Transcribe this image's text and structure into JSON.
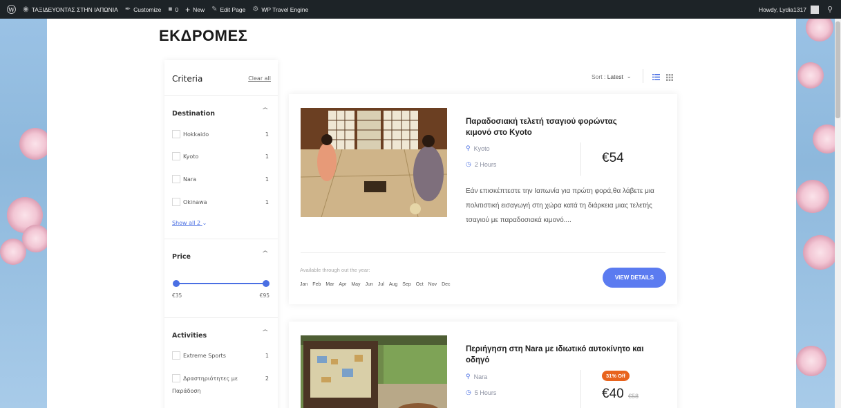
{
  "admin_bar": {
    "site_name": "ΤΑΞΙΔΕΥΟΝΤΑΣ ΣΤΗΝ ΙΑΠΩΝΙΑ",
    "customize": "Customize",
    "comments_count": "0",
    "new": "New",
    "edit_page": "Edit Page",
    "travel_engine": "WP Travel Engine",
    "howdy": "Howdy, Lydia1317"
  },
  "page": {
    "title": "ΕΚΔΡΟΜΕΣ"
  },
  "sidebar": {
    "heading": "Criteria",
    "clear_all": "Clear all",
    "destination": {
      "title": "Destination",
      "items": [
        {
          "label": "Hokkaido",
          "count": "1"
        },
        {
          "label": "Kyoto",
          "count": "1"
        },
        {
          "label": "Nara",
          "count": "1"
        },
        {
          "label": "Okinawa",
          "count": "1"
        }
      ],
      "show_all": "Show all 2"
    },
    "price": {
      "title": "Price",
      "min": "€35",
      "max": "€95"
    },
    "activities": {
      "title": "Activities",
      "items": [
        {
          "label": "Extreme Sports",
          "count": "1"
        },
        {
          "label": "Δραστηριότητες με",
          "label2": "Παράδοση",
          "count": "2"
        }
      ]
    }
  },
  "toolbar": {
    "sort_label": "Sort :",
    "sort_value": "Latest"
  },
  "trips": [
    {
      "title_line1": "Παραδοσιακή τελετή τσαγιού φορώντας",
      "title_line2": "κιμονό στο Kyoto",
      "location": "Kyoto",
      "duration": "2 Hours",
      "price": "€54",
      "desc": "Εάν επισκέπτεστε την Ιαπωνία για πρώτη φορά,θα λάβετε μια πολιτιστική εισαγωγή στη χώρα κατά τη διάρκεια μιας τελετής τσαγιού με παραδοσιακά κιμονό....",
      "availability": "Available through out the year:",
      "months": [
        "Jan",
        "Feb",
        "Mar",
        "Apr",
        "May",
        "Jun",
        "Jul",
        "Aug",
        "Sep",
        "Oct",
        "Nov",
        "Dec"
      ],
      "button": "VIEW DETAILS"
    },
    {
      "title_line1": "Περιήγηση στη Nara με ιδιωτικό αυτοκίνητο και",
      "title_line2": "οδηγό",
      "location": "Nara",
      "duration": "5 Hours",
      "badge": "31% Off",
      "price": "€40",
      "old_price": "€58"
    }
  ],
  "colors": {
    "accent": "#5b7bf0",
    "badge": "#e8641e",
    "admin_bar": "#1d2327"
  }
}
